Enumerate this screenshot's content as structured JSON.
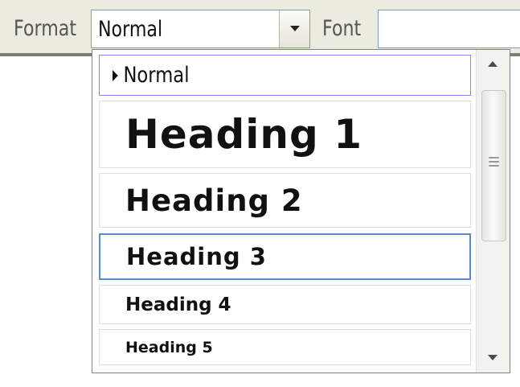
{
  "toolbar": {
    "format_label": "Format",
    "format_value": "Normal",
    "font_label": "Font",
    "font_value": ""
  },
  "dropdown": {
    "items": [
      {
        "label": "Normal",
        "state": "current"
      },
      {
        "label": "Heading 1",
        "state": "default"
      },
      {
        "label": "Heading 2",
        "state": "default"
      },
      {
        "label": "Heading 3",
        "state": "selected"
      },
      {
        "label": "Heading 4",
        "state": "default"
      },
      {
        "label": "Heading 5",
        "state": "default"
      }
    ]
  },
  "scrollbar": {
    "up_icon": "arrow-up-icon",
    "down_icon": "arrow-down-icon",
    "thumb_grip_icon": "grip-icon"
  },
  "colors": {
    "background": "#ecebe0",
    "selection_border": "#5a8ad0",
    "hover_border": "#8585f5",
    "toolbar_separator": "#7c7b75"
  }
}
